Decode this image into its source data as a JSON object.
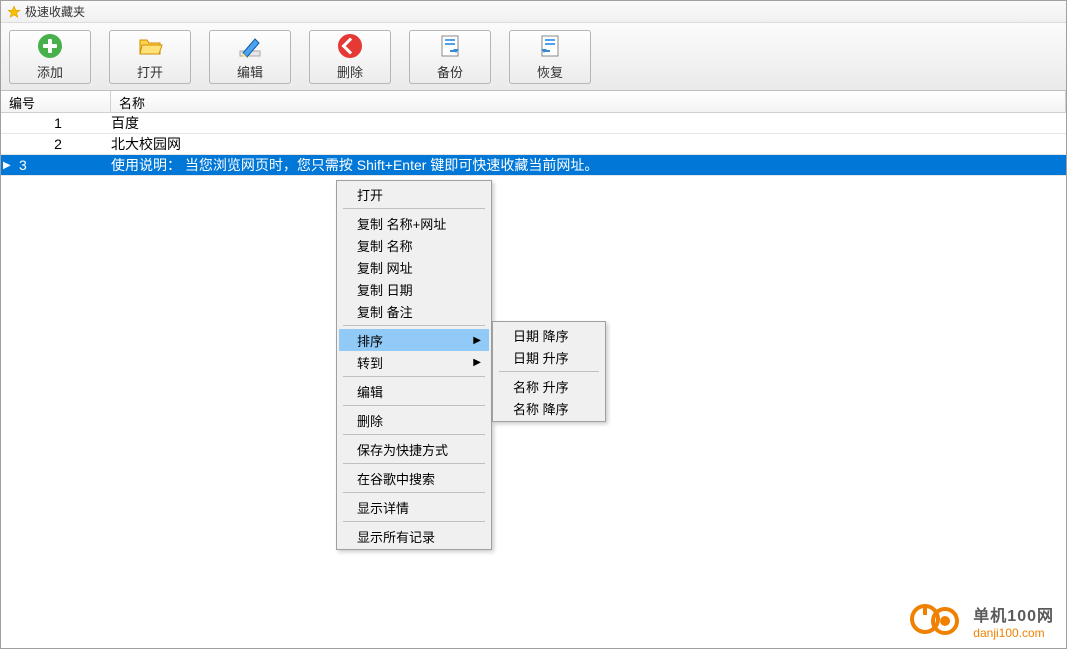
{
  "window": {
    "title": "极速收藏夹"
  },
  "toolbar": {
    "add": "添加",
    "open": "打开",
    "edit": "编辑",
    "delete": "删除",
    "backup": "备份",
    "restore": "恢复"
  },
  "columns": {
    "id": "编号",
    "name": "名称"
  },
  "rows": [
    {
      "id": "1",
      "name": "百度"
    },
    {
      "id": "2",
      "name": "北大校园网"
    },
    {
      "id": "3",
      "name": "使用说明：  当您浏览网页时，您只需按 Shift+Enter 键即可快速收藏当前网址。"
    }
  ],
  "context_menu": {
    "open": "打开",
    "copy_name_url": "复制 名称+网址",
    "copy_name": "复制 名称",
    "copy_url": "复制 网址",
    "copy_date": "复制 日期",
    "copy_remark": "复制 备注",
    "sort": "排序",
    "goto": "转到",
    "edit": "编辑",
    "delete": "删除",
    "save_shortcut": "保存为快捷方式",
    "search_google": "在谷歌中搜索",
    "show_detail": "显示详情",
    "show_all": "显示所有记录"
  },
  "submenu": {
    "date_desc": "日期 降序",
    "date_asc": "日期 升序",
    "name_asc": "名称 升序",
    "name_desc": "名称 降序"
  },
  "watermark": {
    "line1": "单机100网",
    "line2": "danji100.com"
  }
}
